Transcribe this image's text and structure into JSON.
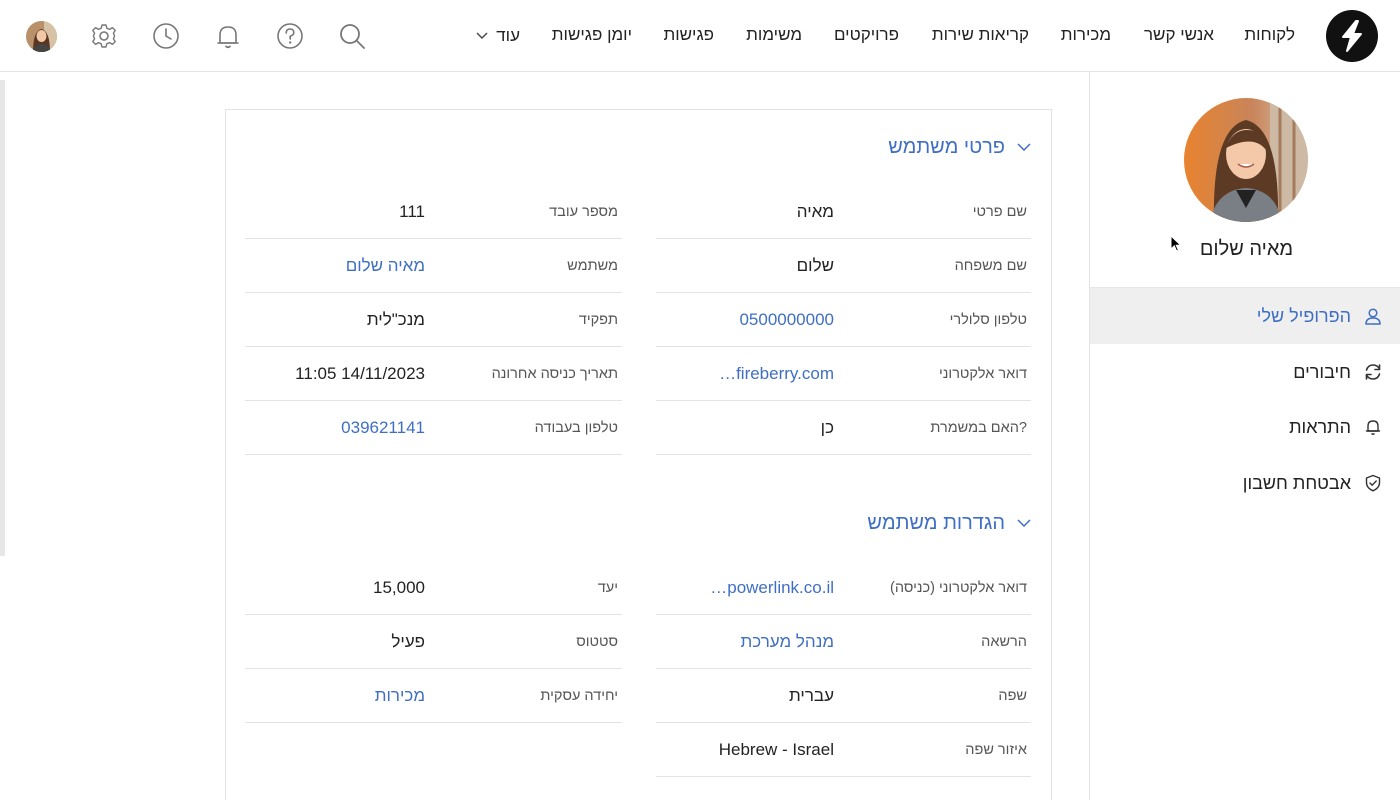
{
  "nav": {
    "items": [
      "לקוחות",
      "אנשי קשר",
      "מכירות",
      "קריאות שירות",
      "פרויקטים",
      "משימות",
      "פגישות",
      "יומן פגישות"
    ],
    "more_label": "עוד"
  },
  "sidebar": {
    "user_name": "מאיה שלום",
    "menu": [
      {
        "label": "הפרופיל שלי",
        "icon": "user-icon",
        "active": true
      },
      {
        "label": "חיבורים",
        "icon": "sync-icon",
        "active": false
      },
      {
        "label": "התראות",
        "icon": "bell-icon",
        "active": false
      },
      {
        "label": "אבטחת חשבון",
        "icon": "shield-icon",
        "active": false
      }
    ]
  },
  "sections": [
    {
      "title": "פרטי משתמש",
      "right_fields": [
        {
          "label": "שם פרטי",
          "value": "מאיה",
          "link": false
        },
        {
          "label": "שם משפחה",
          "value": "שלום",
          "link": false
        },
        {
          "label": "טלפון סלולרי",
          "value": "0500000000",
          "link": true
        },
        {
          "label": "דואר אלקטרוני",
          "value": "…fireberry.com",
          "link": true
        },
        {
          "label": "האם במשמרת?",
          "value": "כן",
          "link": false
        }
      ],
      "left_fields": [
        {
          "label": "מספר עובד",
          "value": "111",
          "link": false
        },
        {
          "label": "משתמש",
          "value": "מאיה שלום",
          "link": true
        },
        {
          "label": "תפקיד",
          "value": "מנכ\"לית",
          "link": false
        },
        {
          "label": "תאריך כניסה אחרונה",
          "value": "11:05 14/11/2023",
          "link": false
        },
        {
          "label": "טלפון בעבודה",
          "value": "039621141",
          "link": true
        }
      ]
    },
    {
      "title": "הגדרות משתמש",
      "right_fields": [
        {
          "label": "דואר אלקטרוני (כניסה)",
          "value": "…powerlink.co.il",
          "link": true
        },
        {
          "label": "הרשאה",
          "value": "מנהל מערכת",
          "link": true
        },
        {
          "label": "שפה",
          "value": "עברית",
          "link": false
        },
        {
          "label": "איזור שפה",
          "value": "Hebrew - Israel",
          "link": false
        }
      ],
      "left_fields": [
        {
          "label": "יעד",
          "value": "15,000",
          "link": false
        },
        {
          "label": "סטטוס",
          "value": "פעיל",
          "link": false
        },
        {
          "label": "יחידה עסקית",
          "value": "מכירות",
          "link": true
        }
      ]
    }
  ],
  "colors": {
    "accent": "#3f6fc4",
    "border": "#e3e3e3",
    "active_bg": "#efefef"
  }
}
